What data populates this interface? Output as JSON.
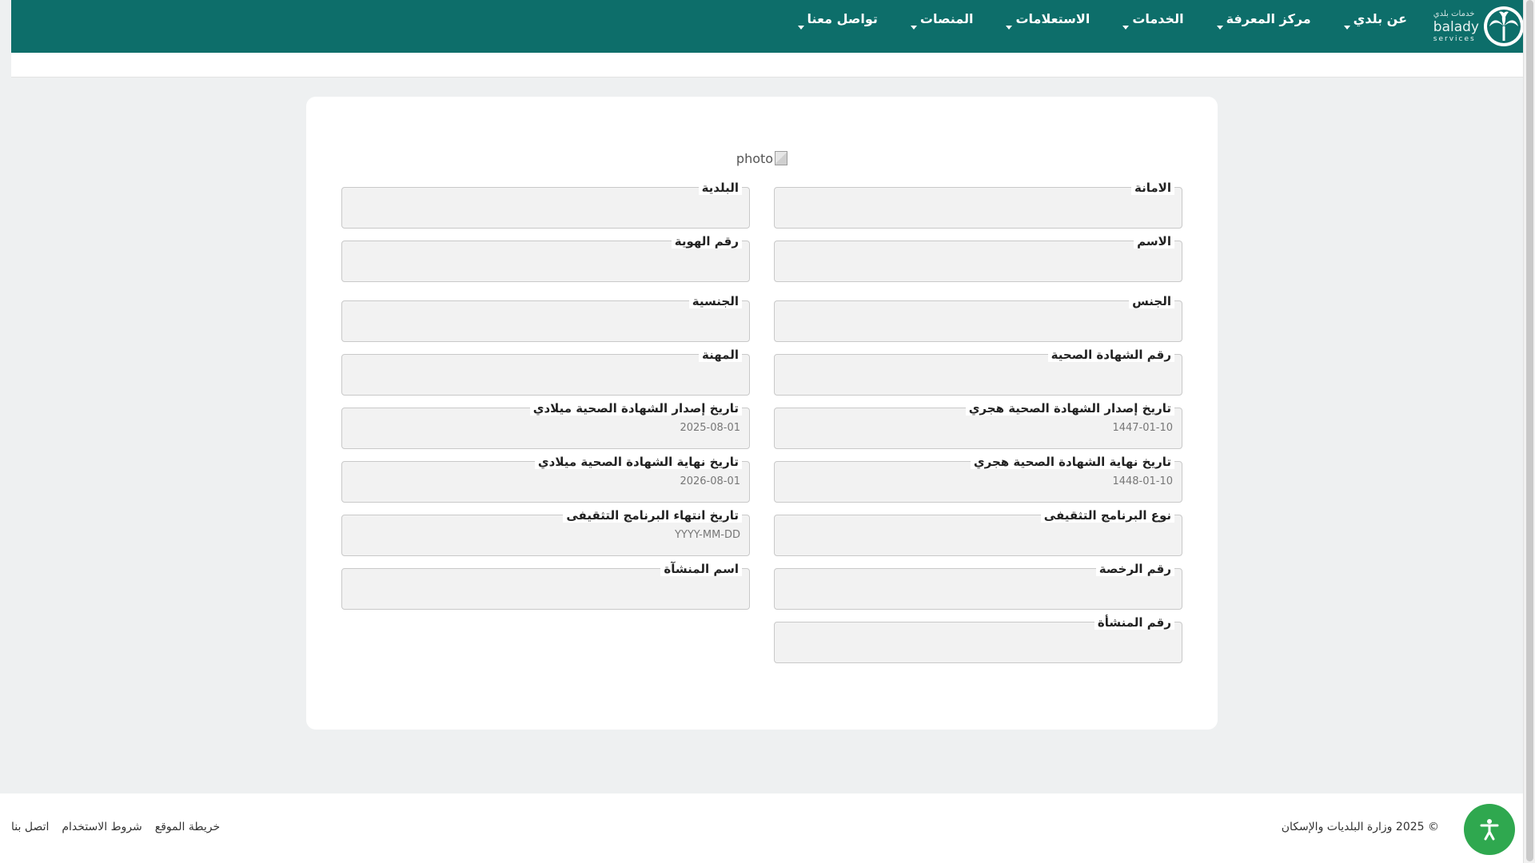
{
  "header": {
    "logo": {
      "arabic": "خدمات بلدي",
      "english": "balady",
      "sub": "services",
      "icon": "palm-tree-icon"
    },
    "nav": [
      {
        "label": "عن بلدي",
        "icon": "caret-down-icon"
      },
      {
        "label": "مركز المعرفة",
        "icon": "caret-down-icon"
      },
      {
        "label": "الخدمات",
        "icon": "caret-down-icon"
      },
      {
        "label": "الاستعلامات",
        "icon": "caret-down-icon"
      },
      {
        "label": "المنصات",
        "icon": "caret-down-icon"
      },
      {
        "label": "تواصل معنا",
        "icon": "caret-down-icon"
      }
    ],
    "color": "#0d6e6a"
  },
  "card": {
    "photo_alt": "photo",
    "fields": [
      {
        "label": "الامانة",
        "value": ""
      },
      {
        "label": "البلدية",
        "value": ""
      },
      {
        "label": "الاسم",
        "value": ""
      },
      {
        "label": "رقم الهوية",
        "value": ""
      },
      {
        "label": "الجنس",
        "value": ""
      },
      {
        "label": "الجنسية",
        "value": ""
      },
      {
        "label": "رقم الشهادة الصحية",
        "value": ""
      },
      {
        "label": "المهنة",
        "value": ""
      },
      {
        "label": "تاريخ إصدار الشهادة الصحية هجري",
        "value": "1447-01-10"
      },
      {
        "label": "تاريخ إصدار الشهادة الصحية ميلادي",
        "value": "2025-08-01"
      },
      {
        "label": "تاريخ نهاية الشهادة الصحية هجري",
        "value": "1448-01-10"
      },
      {
        "label": "تاريخ نهاية الشهادة الصحية ميلادي",
        "value": "2026-08-01"
      },
      {
        "label": "نوع البرنامج التثقيفى",
        "value": ""
      },
      {
        "label": "تاريخ انتهاء البرنامج التثقيفى",
        "value": "YYYY-MM-DD"
      },
      {
        "label": "رقم الرخصة",
        "value": ""
      },
      {
        "label": "اسم المنشآة",
        "value": ""
      },
      {
        "label": "رقم المنشأة",
        "value": ""
      }
    ]
  },
  "footer": {
    "copyright": "© 2025 وزارة البلديات والإسكان",
    "links": [
      {
        "label": "اتصل بنا"
      },
      {
        "label": "شروط الاستخدام"
      },
      {
        "label": "خريطة الموقع"
      }
    ]
  },
  "accessibility": {
    "icon": "accessibility-icon",
    "color": "#2fa84f"
  }
}
